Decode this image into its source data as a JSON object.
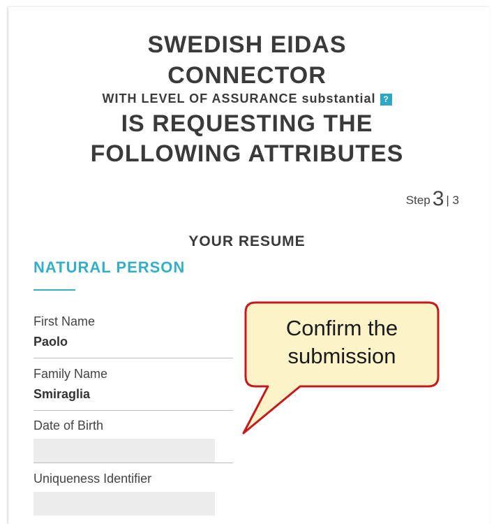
{
  "header": {
    "title_line1": "SWEDISH EIDAS",
    "title_line2": "CONNECTOR",
    "loa_text": "WITH LEVEL OF ASSURANCE substantial",
    "help_icon": "?",
    "title_line3": "IS REQUESTING THE",
    "title_line4": "FOLLOWING ATTRIBUTES"
  },
  "step": {
    "label": "Step",
    "current": "3",
    "separator": "|",
    "total": "3"
  },
  "resume": {
    "heading": "YOUR RESUME",
    "section": "NATURAL PERSON",
    "fields": [
      {
        "label": "First Name",
        "value": "Paolo"
      },
      {
        "label": "Family Name",
        "value": "Smiraglia"
      },
      {
        "label": "Date of Birth",
        "value": ""
      },
      {
        "label": "Uniqueness Identifier",
        "value": ""
      }
    ]
  },
  "callout": {
    "line1": "Confirm the",
    "line2": "submission"
  },
  "colors": {
    "accent": "#35aec6",
    "callout_fill": "#fdf3c9",
    "callout_border": "#c41a1a"
  }
}
